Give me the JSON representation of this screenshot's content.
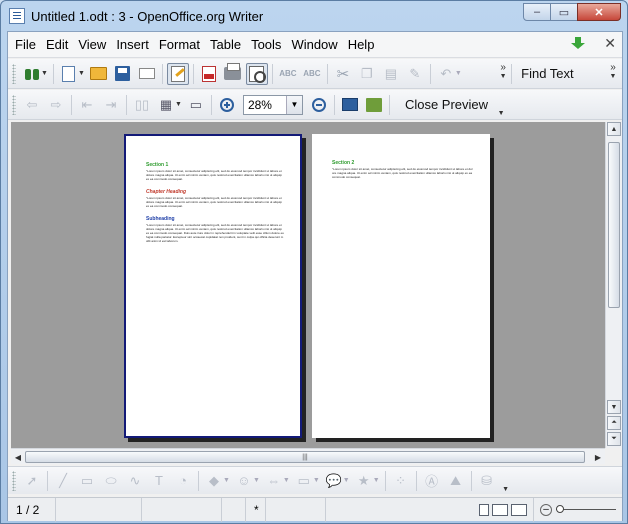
{
  "window": {
    "title": "Untitled 1.odt : 3 - OpenOffice.org Writer",
    "minimize": "–",
    "maximize": "▭",
    "close": "✕"
  },
  "menubar": {
    "items": [
      "File",
      "Edit",
      "View",
      "Insert",
      "Format",
      "Table",
      "Tools",
      "Window",
      "Help"
    ],
    "close_doc": "✕"
  },
  "toolbar_standard": {
    "find_text": "Find Text",
    "more": "»"
  },
  "toolbar_preview": {
    "zoom_value": "28%",
    "close_preview": "Close Preview"
  },
  "document": {
    "left_page": {
      "blocks": [
        {
          "heading": "Section 1",
          "heading_color": "#2e9b2e",
          "heading_style": "normal",
          "body": "\"Lorem ipsum dolor sit amet, consectetur adipiscing elit, sed do eiusmod tempor incididunt ut labore et dolore magna aliqua. Ut enim ad minim veniam, quis nostrud exercitation ullamco laboris nisi ut aliquip ex ea commodo consequat."
        },
        {
          "heading": "Chapter Heading",
          "heading_color": "#c0392b",
          "heading_style": "italic",
          "body": "\"Lorem ipsum dolor sit amet, consectetur adipiscing elit, sed do eiusmod tempor incididunt ut labore et dolore magna aliqua. Ut enim ad minim veniam, quis nostrud exercitation ullamco laboris nisi ut aliquip ex ea commodo consequat."
        },
        {
          "heading": "Subheading",
          "heading_color": "#1f3fa8",
          "heading_style": "normal",
          "body": "\"Lorem ipsum dolor sit amet, consectetur adipiscing elit, sed do eiusmod tempor incididunt ut labore et dolore magna aliqua. Ut enim ad minim veniam, quis nostrud exercitation ullamco laboris nisi ut aliquip ex ea commodo consequat. Duis aute irure dolor in reprehenderit in voluptate velit esse cillum dolore eu fugiat nulla pariatur. Excepteur sint occaecat cupidatat non proident, sunt in culpa qui officia deserunt mollit anim id est laborum."
        }
      ]
    },
    "right_page": {
      "blocks": [
        {
          "heading": "Section 2",
          "heading_color": "#2e9b2e",
          "heading_style": "normal",
          "body": "\"Lorem ipsum dolor sit amet, consectetur adipiscing elit, sed do eiusmod tempor incididunt ut labore et dolore magna aliqua. Ut enim ad minim veniam, quis nostrud exercitation ullamco laboris nisi ut aliquip ex ea commodo consequat."
        }
      ]
    }
  },
  "hscroll": {
    "thumb_grip": "|||"
  },
  "statusbar": {
    "page": "1 / 2",
    "modified": "*",
    "zoom_minus": "–"
  }
}
